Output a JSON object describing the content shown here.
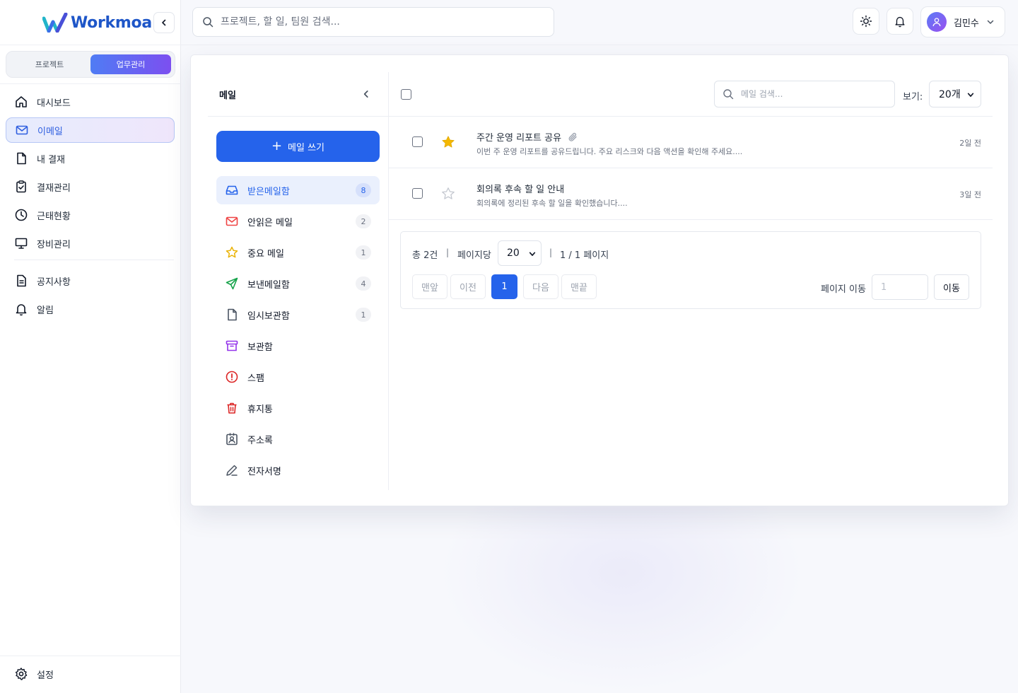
{
  "brand": {
    "name": "Workmoa"
  },
  "mode_switch": {
    "project": "프로젝트",
    "work": "업무관리"
  },
  "nav": {
    "items": [
      {
        "label": "대시보드",
        "icon": "home-icon"
      },
      {
        "label": "이메일",
        "icon": "mail-icon",
        "active": true
      },
      {
        "label": "내 결재",
        "icon": "document-icon"
      },
      {
        "label": "결재관리",
        "icon": "clipboard-check-icon"
      },
      {
        "label": "근태현황",
        "icon": "clock-icon"
      },
      {
        "label": "장비관리",
        "icon": "monitor-icon"
      }
    ],
    "secondary": [
      {
        "label": "공지사항",
        "icon": "notice-icon"
      },
      {
        "label": "알림",
        "icon": "bell-icon"
      }
    ],
    "settings": "설정"
  },
  "header": {
    "search_placeholder": "프로젝트, 할 일, 팀원 검색...",
    "user_name": "김민수"
  },
  "mail": {
    "title": "메일",
    "compose_label": "메일 쓰기",
    "folders": [
      {
        "label": "받은메일함",
        "count": "8",
        "icon": "inbox-icon",
        "color": "#2563eb",
        "active": true
      },
      {
        "label": "안읽은 메일",
        "count": "2",
        "icon": "mail-icon",
        "color": "#ef4444"
      },
      {
        "label": "중요 메일",
        "count": "1",
        "icon": "star-icon",
        "color": "#eab308"
      },
      {
        "label": "보낸메일함",
        "count": "4",
        "icon": "send-icon",
        "color": "#16a34a"
      },
      {
        "label": "임시보관함",
        "count": "1",
        "icon": "document-icon",
        "color": "#4b5563"
      },
      {
        "label": "보관함",
        "count": "",
        "icon": "archive-icon",
        "color": "#9333ea"
      },
      {
        "label": "스팸",
        "count": "",
        "icon": "alert-circle-icon",
        "color": "#dc2626"
      },
      {
        "label": "휴지통",
        "count": "",
        "icon": "trash-icon",
        "color": "#dc2626"
      },
      {
        "label": "주소록",
        "count": "",
        "icon": "contact-icon",
        "color": "#4b5563"
      },
      {
        "label": "전자서명",
        "count": "",
        "icon": "pen-icon",
        "color": "#4b5563"
      }
    ],
    "search_placeholder": "메일 검색...",
    "view_label": "보기:",
    "view_value": "20개",
    "messages": [
      {
        "subject": "주간 운영 리포트 공유",
        "preview": "이번 주 운영 리포트를 공유드립니다. 주요 리스크와 다음 액션을 확인해 주세요....",
        "time": "2일 전",
        "starred": true,
        "attachment": true
      },
      {
        "subject": "회의록 후속 할 일 안내",
        "preview": "회의록에 정리된 후속 할 일을 확인했습니다....",
        "time": "3일 전",
        "starred": false,
        "attachment": false
      }
    ],
    "pagination": {
      "total": "총 2건",
      "per_page_label": "페이지당",
      "per_page_value": "20",
      "page_info": "1 / 1 페이지",
      "sep": "|",
      "first": "맨앞",
      "prev": "이전",
      "current": "1",
      "next": "다음",
      "last": "맨끝",
      "goto_label": "페이지 이동",
      "goto_placeholder": "1",
      "goto_button": "이동"
    }
  },
  "colors": {
    "accent": "#2563eb",
    "star": "#f5b800",
    "brand_gradient_start": "#4f7cf4",
    "brand_gradient_end": "#7c4ff0"
  }
}
